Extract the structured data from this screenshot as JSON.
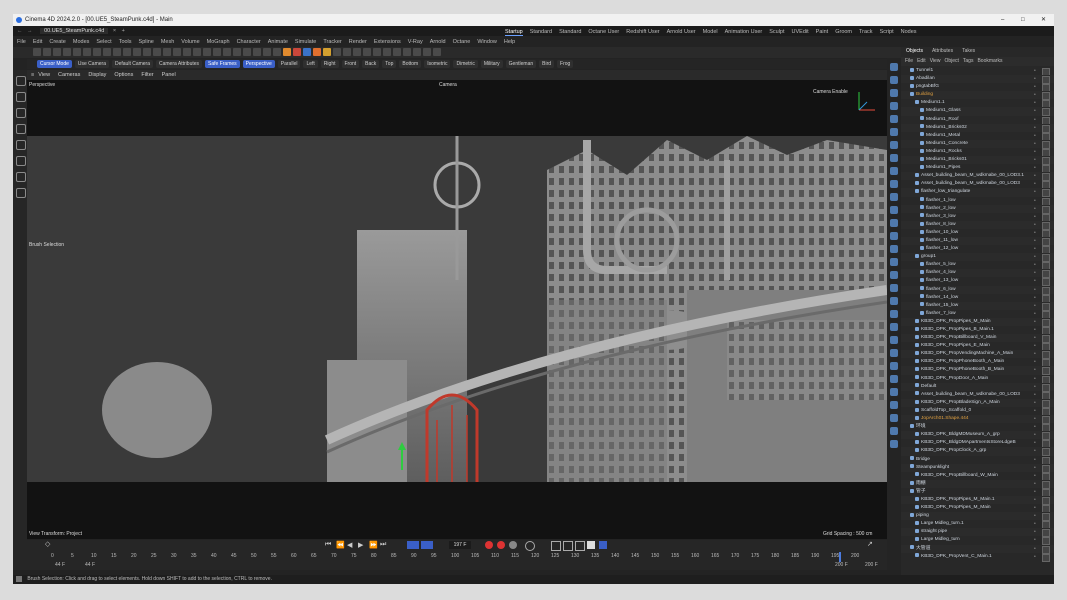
{
  "titlebar": {
    "title": "Cinema 4D 2024.2.0 - [00.UE5_SteamPunk.c4d] - Main"
  },
  "doc_tab": {
    "label": "00.UE5_SteamPunk.c4d"
  },
  "menu": [
    "File",
    "Edit",
    "Create",
    "Modes",
    "Select",
    "Tools",
    "Spline",
    "Mesh",
    "Volume",
    "MoGraph",
    "Character",
    "Animate",
    "Simulate",
    "Tracker",
    "Render",
    "Extensions",
    "V-Ray",
    "Arnold",
    "Octane",
    "Window",
    "Help"
  ],
  "layouts": [
    "Startup",
    "Standard",
    "Standard",
    "Octane User",
    "Redshift User",
    "Arnold User",
    "Model",
    "Animation User",
    "Sculpt",
    "UVEdit",
    "Paint",
    "Groom",
    "Track",
    "Script",
    "Nodes"
  ],
  "layout_active": 0,
  "modebar": [
    "Cursor Mode",
    "Use Camera",
    "Default Camera",
    "Camera Attributes",
    "Safe Frames",
    "Perspective",
    "Parallel",
    "Left",
    "Right",
    "Front",
    "Back",
    "Top",
    "Bottom",
    "Isometric",
    "Dimetric",
    "Military",
    "Gentleman",
    "Bird",
    "Frog"
  ],
  "viewport_menu": [
    "View",
    "Cameras",
    "Display",
    "Options",
    "Filter",
    "Panel"
  ],
  "viewport": {
    "label": "Perspective",
    "camera": "Camera",
    "camera_enable": "Camera Enable",
    "brush_selection": "Brush Selection",
    "transform": "View Transform: Project",
    "grid_spacing": "Grid Spacing : 500 cm"
  },
  "panel_tabs": [
    "Objects",
    "Attributes",
    "Takes"
  ],
  "panel_menu": [
    "File",
    "Edit",
    "View",
    "Object",
    "Tags",
    "Bookmarks"
  ],
  "objects": [
    {
      "name": "Tunnel1",
      "indent": 1,
      "color": ""
    },
    {
      "name": "Abadilan",
      "indent": 1,
      "color": ""
    },
    {
      "name": "pngtabBfG",
      "indent": 1,
      "color": ""
    },
    {
      "name": "Building",
      "indent": 1,
      "color": "#e0a040"
    },
    {
      "name": "Medium1.1",
      "indent": 2,
      "color": ""
    },
    {
      "name": "Medium1_Glass",
      "indent": 3,
      "color": ""
    },
    {
      "name": "Medium1_Roof",
      "indent": 3,
      "color": ""
    },
    {
      "name": "Medium1_Bricks02",
      "indent": 3,
      "color": ""
    },
    {
      "name": "Medium1_Metal",
      "indent": 3,
      "color": ""
    },
    {
      "name": "Medium1_Concrete",
      "indent": 3,
      "color": ""
    },
    {
      "name": "Medium1_Rocks",
      "indent": 3,
      "color": ""
    },
    {
      "name": "Medium1_Bricks01",
      "indent": 3,
      "color": ""
    },
    {
      "name": "Medium1_Pipes",
      "indent": 3,
      "color": ""
    },
    {
      "name": "Asset_building_beam_M_wdkmabe_00_LOD3.1",
      "indent": 2,
      "color": ""
    },
    {
      "name": "Asset_building_beam_M_wdkmabe_00_LOD3",
      "indent": 2,
      "color": ""
    },
    {
      "name": "flasher_low_triangulate",
      "indent": 2,
      "color": ""
    },
    {
      "name": "flasher_1_low",
      "indent": 3,
      "color": ""
    },
    {
      "name": "flasher_2_low",
      "indent": 3,
      "color": ""
    },
    {
      "name": "flasher_3_low",
      "indent": 3,
      "color": ""
    },
    {
      "name": "flasher_8_low",
      "indent": 3,
      "color": ""
    },
    {
      "name": "flasher_10_low",
      "indent": 3,
      "color": ""
    },
    {
      "name": "flasher_11_low",
      "indent": 3,
      "color": ""
    },
    {
      "name": "flasher_12_low",
      "indent": 3,
      "color": ""
    },
    {
      "name": "group1",
      "indent": 2,
      "color": ""
    },
    {
      "name": "flasher_5_low",
      "indent": 3,
      "color": ""
    },
    {
      "name": "flasher_4_low",
      "indent": 3,
      "color": ""
    },
    {
      "name": "flasher_13_low",
      "indent": 3,
      "color": ""
    },
    {
      "name": "flasher_6_low",
      "indent": 3,
      "color": ""
    },
    {
      "name": "flasher_14_low",
      "indent": 3,
      "color": ""
    },
    {
      "name": "flasher_15_low",
      "indent": 3,
      "color": ""
    },
    {
      "name": "flasher_7_low",
      "indent": 3,
      "color": ""
    },
    {
      "name": "KB3D_DPK_PropPipes_M_Main",
      "indent": 2,
      "color": ""
    },
    {
      "name": "KB3D_DPK_PropPipes_B_Main.1",
      "indent": 2,
      "color": ""
    },
    {
      "name": "KB3D_DPK_PropBillboard_V_Main",
      "indent": 2,
      "color": ""
    },
    {
      "name": "KB3D_DPK_PropPipes_E_Main",
      "indent": 2,
      "color": ""
    },
    {
      "name": "KB3D_DPK_PropVendingMachine_A_Main",
      "indent": 2,
      "color": ""
    },
    {
      "name": "KB3D_DPK_PropPhoneBooth_A_Main",
      "indent": 2,
      "color": ""
    },
    {
      "name": "KB3D_DPK_PropPhoneBooth_B_Main",
      "indent": 2,
      "color": ""
    },
    {
      "name": "KB3D_DPK_PropDoor_A_Main",
      "indent": 2,
      "color": ""
    },
    {
      "name": "Default",
      "indent": 2,
      "color": ""
    },
    {
      "name": "Asset_building_beam_M_wdkmabe_00_LOD3",
      "indent": 2,
      "color": ""
    },
    {
      "name": "KB3D_DPK_PropBladeSign_A_Main",
      "indent": 2,
      "color": ""
    },
    {
      "name": "ScaffoldTop_Scaffold_0",
      "indent": 2,
      "color": ""
    },
    {
      "name": "JopArch01.Shape.444",
      "indent": 2,
      "color": "#e0a040"
    },
    {
      "name": "环境",
      "indent": 1,
      "color": ""
    },
    {
      "name": "KB3D_DPK_BldgMDMuseum_A_grp",
      "indent": 2,
      "color": ""
    },
    {
      "name": "KB3D_DPK_BldgDMApartmentsStoreLdgeB",
      "indent": 2,
      "color": ""
    },
    {
      "name": "KB3D_DPK_PropClock_A_grp",
      "indent": 2,
      "color": ""
    },
    {
      "name": "Bridge",
      "indent": 1,
      "color": ""
    },
    {
      "name": "Steampunklight",
      "indent": 1,
      "color": ""
    },
    {
      "name": "KB3D_DPK_PropBillboard_W_Main",
      "indent": 2,
      "color": ""
    },
    {
      "name": "雨棚",
      "indent": 1,
      "color": ""
    },
    {
      "name": "管子",
      "indent": 1,
      "color": ""
    },
    {
      "name": "KB3D_DPK_PropPipes_M_Main.1",
      "indent": 2,
      "color": ""
    },
    {
      "name": "KB3D_DPK_PropPipes_M_Main",
      "indent": 2,
      "color": ""
    },
    {
      "name": "piping",
      "indent": 1,
      "color": ""
    },
    {
      "name": "Large Midleg_turn.1",
      "indent": 2,
      "color": ""
    },
    {
      "name": "straight pipe",
      "indent": 2,
      "color": ""
    },
    {
      "name": "Large Midleg_turn",
      "indent": 2,
      "color": ""
    },
    {
      "name": "大管道",
      "indent": 1,
      "color": ""
    },
    {
      "name": "KB3D_DPK_PropVent_C_Main.1",
      "indent": 2,
      "color": ""
    }
  ],
  "timeline": {
    "ticks": [
      "0",
      "5",
      "10",
      "15",
      "20",
      "25",
      "30",
      "35",
      "40",
      "45",
      "50",
      "55",
      "60",
      "65",
      "70",
      "75",
      "80",
      "85",
      "90",
      "95",
      "100",
      "105",
      "110",
      "115",
      "120",
      "125",
      "130",
      "135",
      "140",
      "145",
      "150",
      "155",
      "160",
      "165",
      "170",
      "175",
      "180",
      "185",
      "190",
      "195",
      "200"
    ],
    "current_frame": "197 F",
    "start": "44 F",
    "start2": "44 F",
    "end": "200 F",
    "end2": "200 F",
    "playhead_fraction": 0.985
  },
  "status": {
    "text": "Brush Selection: Click and drag to select elements. Hold down SHIFT to add to the selection, CTRL to remove."
  }
}
